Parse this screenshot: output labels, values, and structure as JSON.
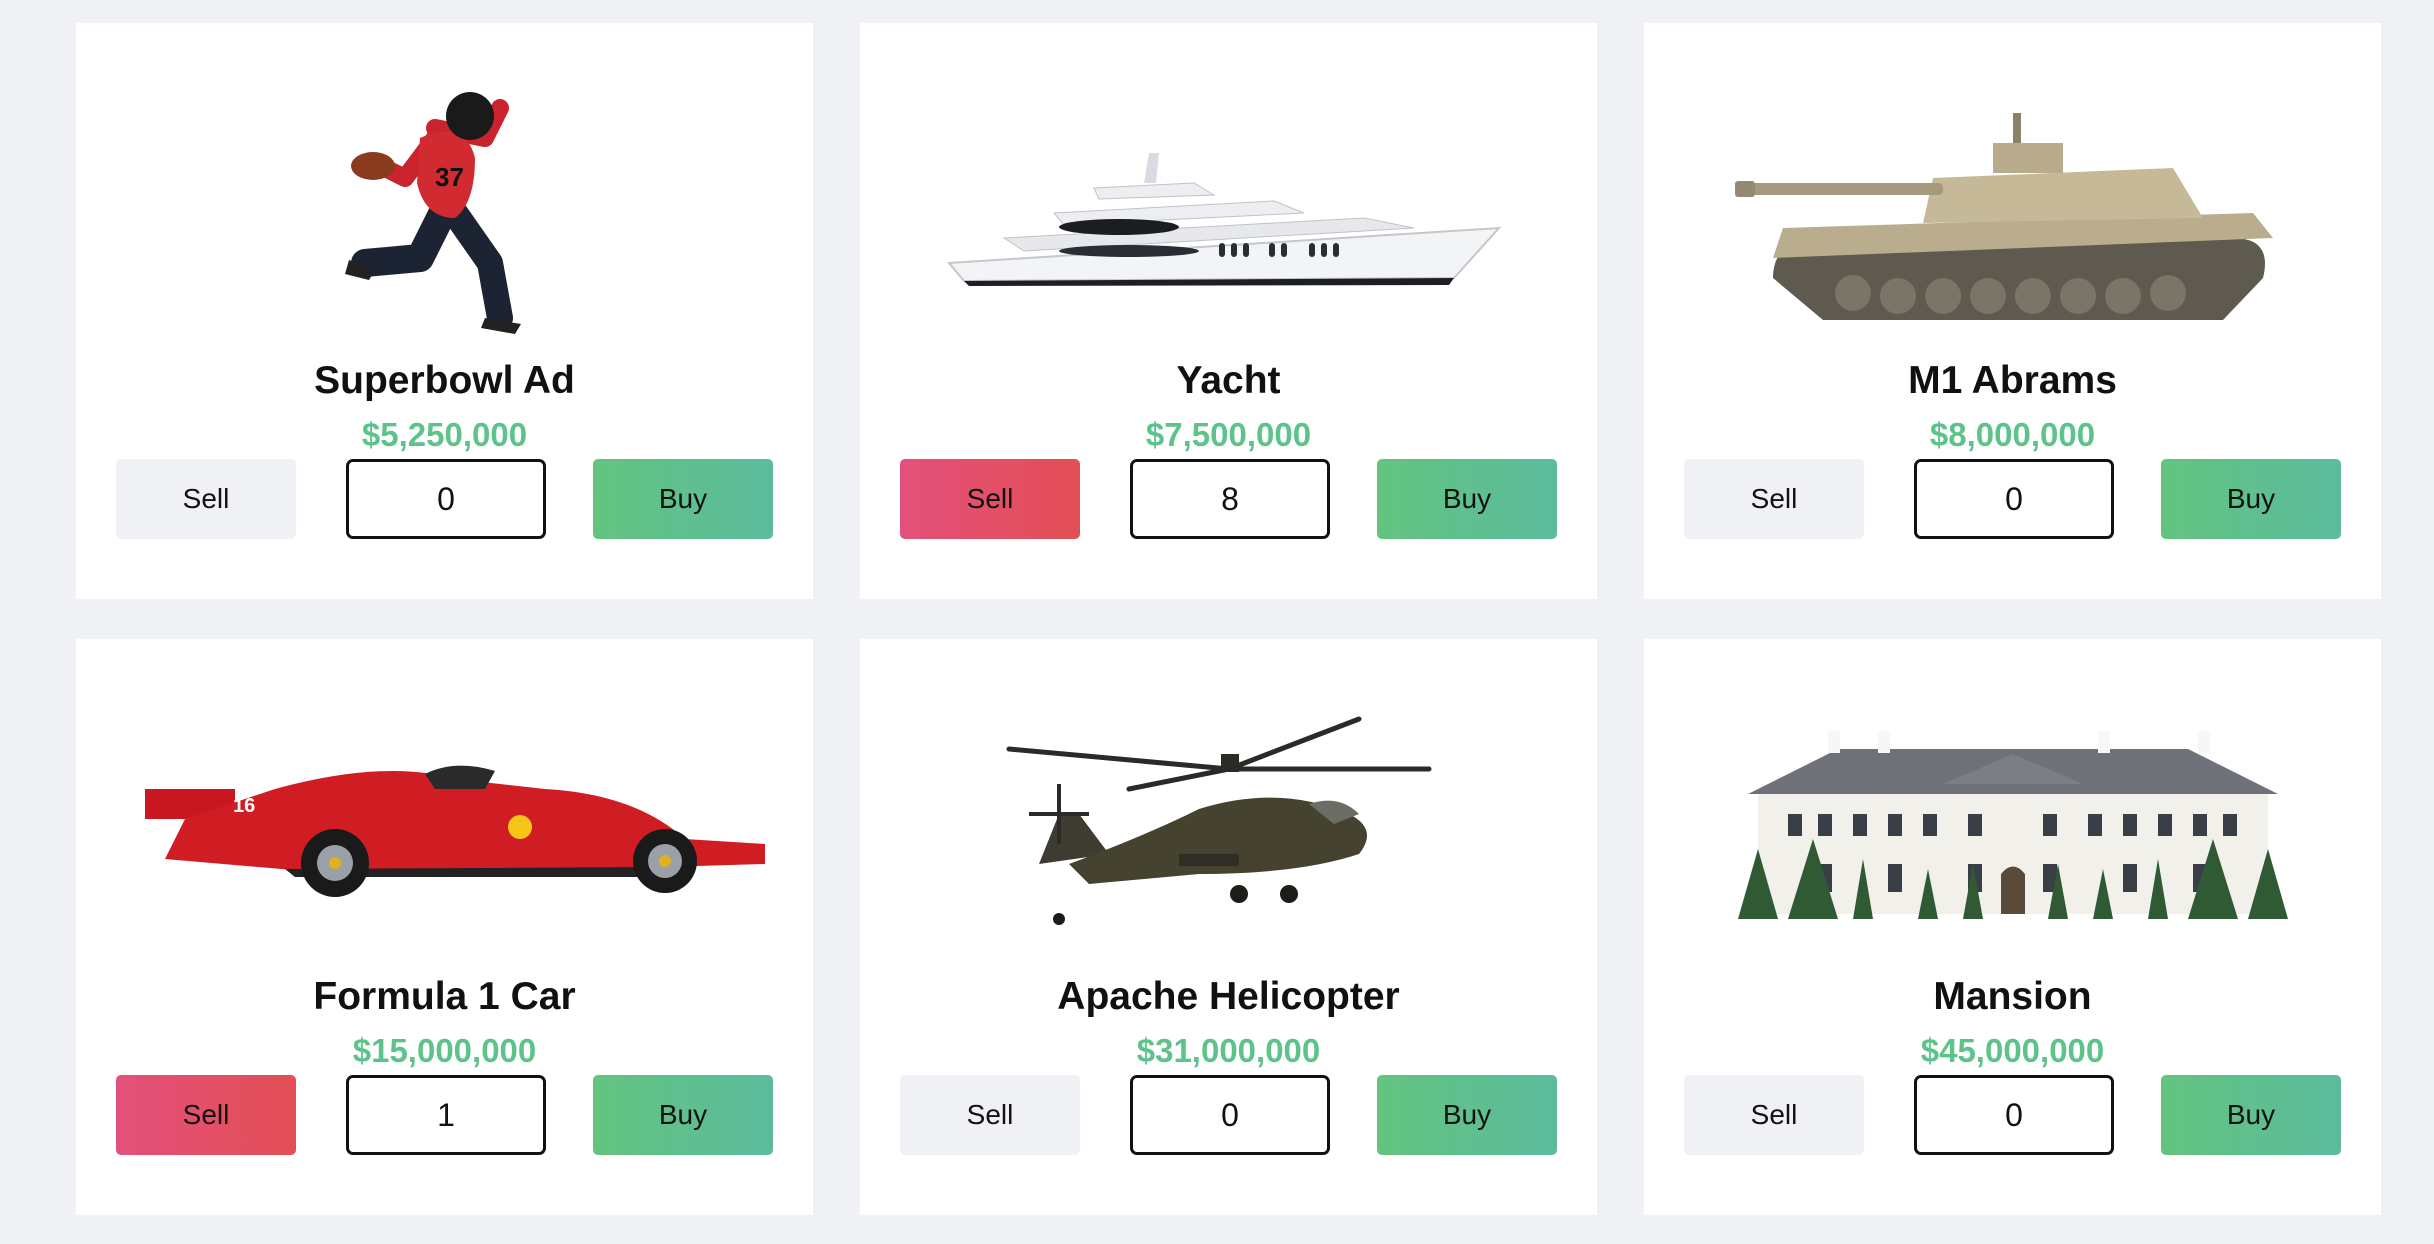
{
  "products": [
    {
      "name": "Superbowl Ad",
      "price": "$5,250,000",
      "quantity": "0",
      "sell_label": "Sell",
      "buy_label": "Buy",
      "sell_active": false,
      "image": "football-player-image"
    },
    {
      "name": "Yacht",
      "price": "$7,500,000",
      "quantity": "8",
      "sell_label": "Sell",
      "buy_label": "Buy",
      "sell_active": true,
      "image": "yacht-image"
    },
    {
      "name": "M1 Abrams",
      "price": "$8,000,000",
      "quantity": "0",
      "sell_label": "Sell",
      "buy_label": "Buy",
      "sell_active": false,
      "image": "tank-image"
    },
    {
      "name": "Formula 1 Car",
      "price": "$15,000,000",
      "quantity": "1",
      "sell_label": "Sell",
      "buy_label": "Buy",
      "sell_active": true,
      "image": "race-car-image"
    },
    {
      "name": "Apache Helicopter",
      "price": "$31,000,000",
      "quantity": "0",
      "sell_label": "Sell",
      "buy_label": "Buy",
      "sell_active": false,
      "image": "helicopter-image"
    },
    {
      "name": "Mansion",
      "price": "$45,000,000",
      "quantity": "0",
      "sell_label": "Sell",
      "buy_label": "Buy",
      "sell_active": false,
      "image": "mansion-image"
    }
  ],
  "colors": {
    "page_background": "#f0f1f5",
    "price": "#5ec38a",
    "buy_button": "#5fc08a",
    "sell_active": "#e3506a",
    "sell_inactive": "#f0f1f5"
  }
}
